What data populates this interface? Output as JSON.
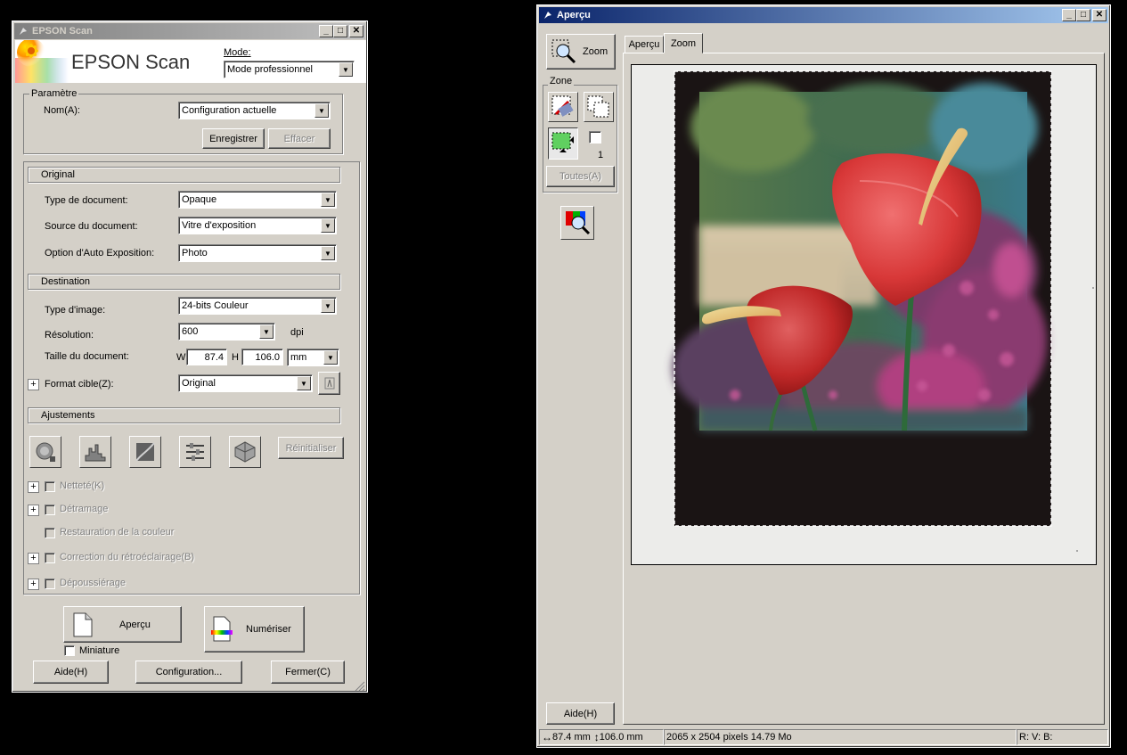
{
  "epson_window": {
    "title": "EPSON Scan",
    "logo_text": "EPSON Scan",
    "mode_label": "Mode:",
    "mode_value": "Mode professionnel",
    "parametre": {
      "legend": "Paramètre",
      "name_label": "Nom(A):",
      "name_value": "Configuration actuelle",
      "save_button": "Enregistrer",
      "delete_button": "Effacer"
    },
    "original": {
      "header": "Original",
      "doc_type_label": "Type de document:",
      "doc_type_value": "Opaque",
      "doc_source_label": "Source du document:",
      "doc_source_value": "Vitre d'exposition",
      "auto_exposure_label": "Option d'Auto Exposition:",
      "auto_exposure_value": "Photo"
    },
    "destination": {
      "header": "Destination",
      "image_type_label": "Type d'image:",
      "image_type_value": "24-bits Couleur",
      "resolution_label": "Résolution:",
      "resolution_value": "600",
      "resolution_unit": "dpi",
      "doc_size_label": "Taille du document:",
      "width_label": "W",
      "width_value": "87.4",
      "height_label": "H",
      "height_value": "106.0",
      "unit_value": "mm",
      "target_format_label": "Format cible(Z):",
      "target_format_value": "Original"
    },
    "adjustments": {
      "header": "Ajustements",
      "reset_button": "Réinitialiser",
      "sharpness": "Netteté(K)",
      "descreening": "Détramage",
      "color_restoration": "Restauration de la couleur",
      "backlight_correction": "Correction du rétroéclairage(B)",
      "dust_removal": "Dépoussiérage"
    },
    "preview_button": "Aperçu",
    "scan_button": "Numériser",
    "thumbnail_label": "Miniature",
    "help_button": "Aide(H)",
    "config_button": "Configuration...",
    "close_button": "Fermer(C)"
  },
  "preview_window": {
    "title": "Aperçu",
    "zoom_button": "Zoom",
    "zone_legend": "Zone",
    "zone_count": "1",
    "all_button": "Toutes(A)",
    "tabs": [
      "Aperçu",
      "Zoom"
    ],
    "help_button": "Aide(H)",
    "status": {
      "width_value": "87.4 mm",
      "height_value": "106.0 mm",
      "pixels": "2065 x 2504 pixels 14.79 Mo",
      "rgb": "R: V: B:"
    }
  }
}
